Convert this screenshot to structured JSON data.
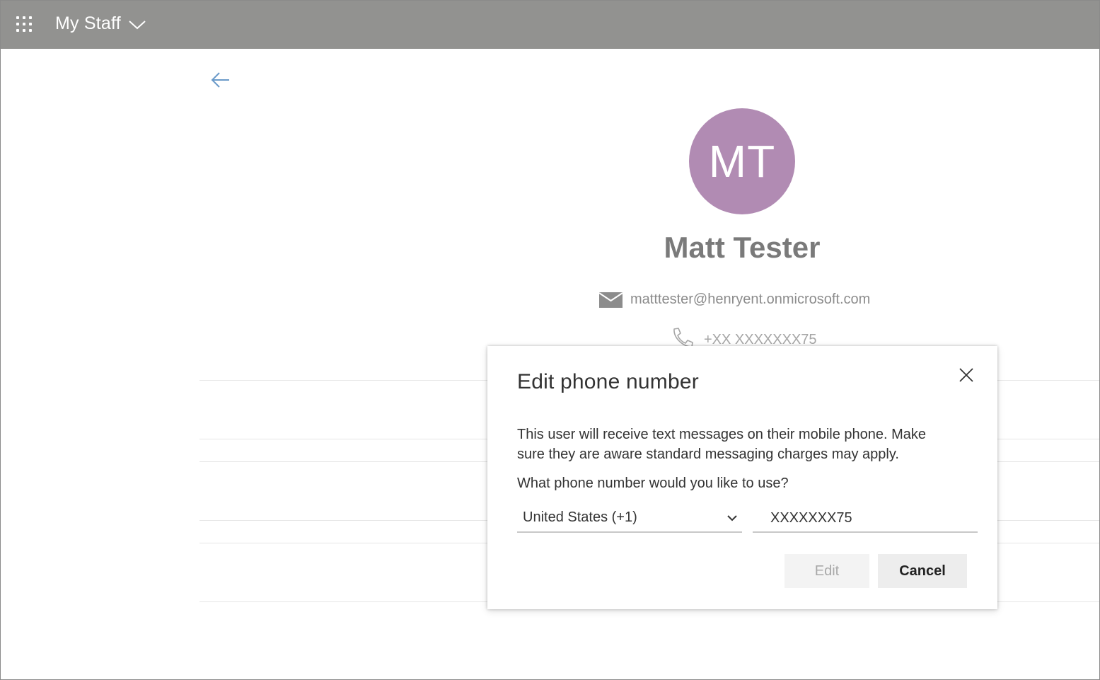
{
  "header": {
    "app_title": "My Staff",
    "waffle_icon": "app-launcher-icon",
    "chevron_icon": "chevron-down-icon",
    "background_color": "#929290"
  },
  "nav": {
    "back_icon": "arrow-left-icon",
    "back_color": "#6a9ac9"
  },
  "profile": {
    "initials": "MT",
    "avatar_color": "#b18bb3",
    "name": "Matt Tester",
    "email": "matttester@henryent.onmicrosoft.com",
    "phone": "+XX XXXXXXX75"
  },
  "dialog": {
    "title": "Edit phone number",
    "body": "This user will receive text messages on their mobile phone. Make sure they are aware standard messaging charges may apply.",
    "question": "What phone number would you like to use?",
    "country_selected": "United States (+1)",
    "phone_value": "XXXXXXX75",
    "edit_label": "Edit",
    "cancel_label": "Cancel"
  }
}
